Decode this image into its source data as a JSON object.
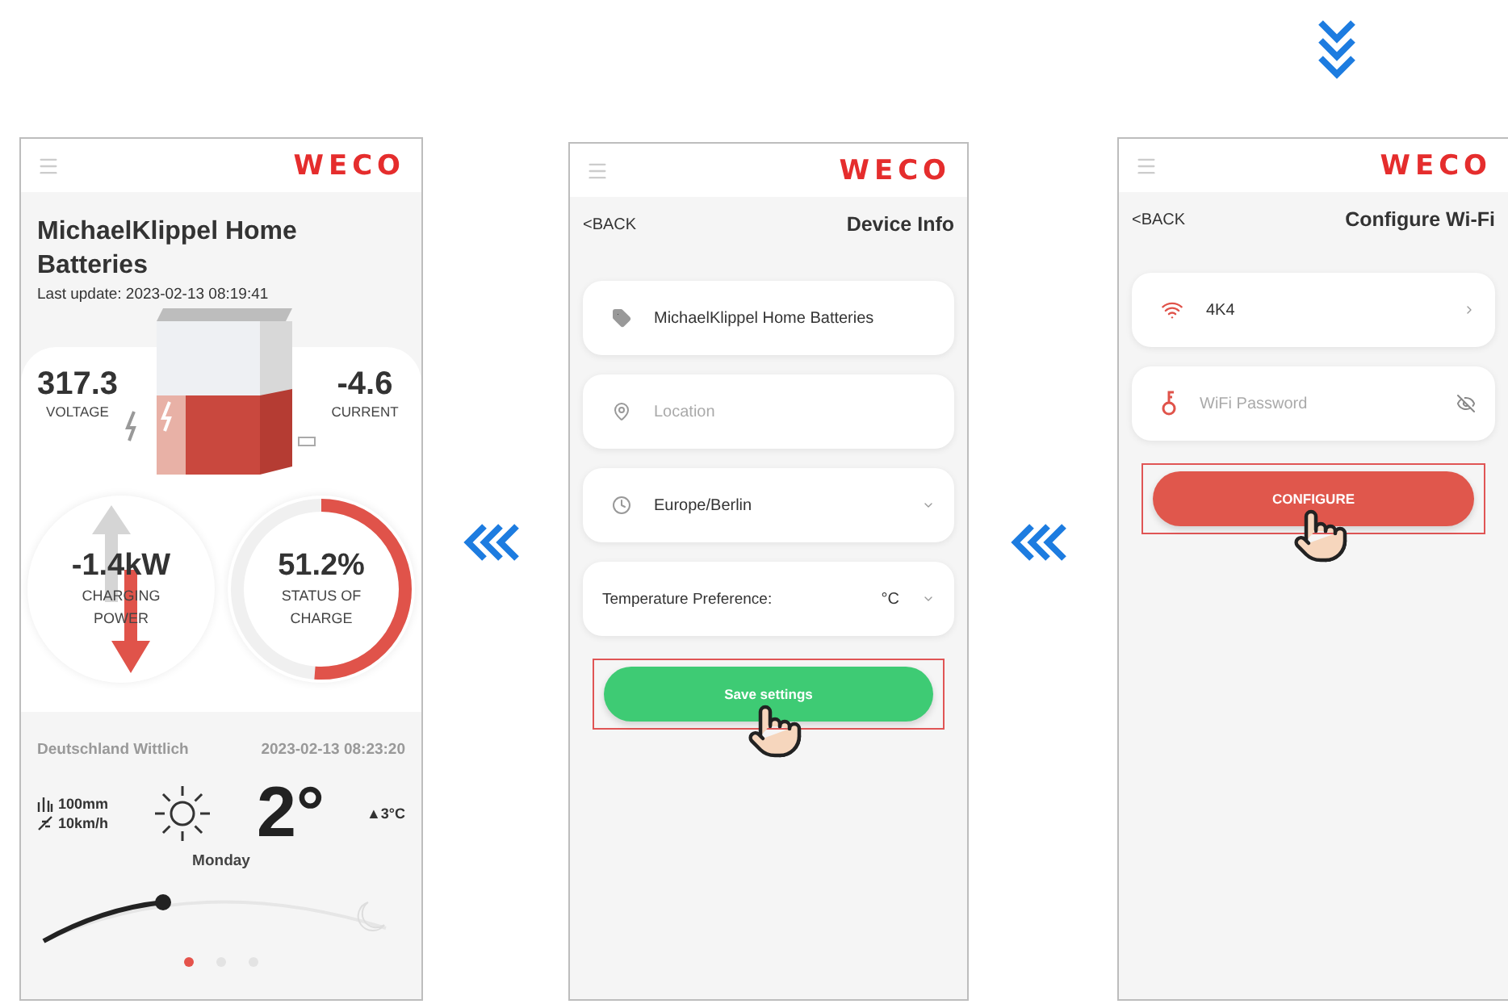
{
  "dashboard_screen": {
    "logo": "WECO",
    "title": "MichaelKlippel Home Batteries",
    "last_update": "Last update:  2023-02-13 08:19:41",
    "voltage": {
      "value": "317.3",
      "label": "VOLTAGE"
    },
    "current": {
      "value": "-4.6",
      "label": "CURRENT"
    },
    "power": {
      "value": "-1.4kW",
      "label": "CHARGING POWER"
    },
    "charge": {
      "value": "51.2%",
      "label": "STATUS OF CHARGE",
      "level": 0.512
    },
    "weather": {
      "location": "Deutschland Wittlich",
      "time": "2023-02-13 08:23:20",
      "rain": "100mm",
      "wind": "10km/h",
      "temperature": "2°",
      "high": "▲3°C",
      "day": "Monday"
    },
    "page_dots": [
      {
        "selected": true
      },
      {
        "selected": false
      },
      {
        "selected": false
      }
    ]
  },
  "device_info_screen": {
    "logo": "WECO",
    "back": "<BACK",
    "title": "Device Info",
    "fields": [
      {
        "kind": "name",
        "value": "MichaelKlippel Home Batteries"
      },
      {
        "kind": "location",
        "placeholder": "Location"
      },
      {
        "kind": "timezone",
        "value": "Europe/Berlin"
      },
      {
        "kind": "temperature",
        "label": "Temperature Preference:",
        "value": "°C"
      }
    ],
    "button": {
      "label": "Save settings",
      "highlighted": true
    }
  },
  "wifi_screen": {
    "logo": "WECO",
    "back": "<BACK",
    "title": "Configure Wi-Fi",
    "fields": [
      {
        "kind": "network",
        "value": "4K4"
      },
      {
        "kind": "password",
        "placeholder": "WiFi Password"
      }
    ],
    "button": {
      "label": "CONFIGURE",
      "highlighted": true
    }
  }
}
